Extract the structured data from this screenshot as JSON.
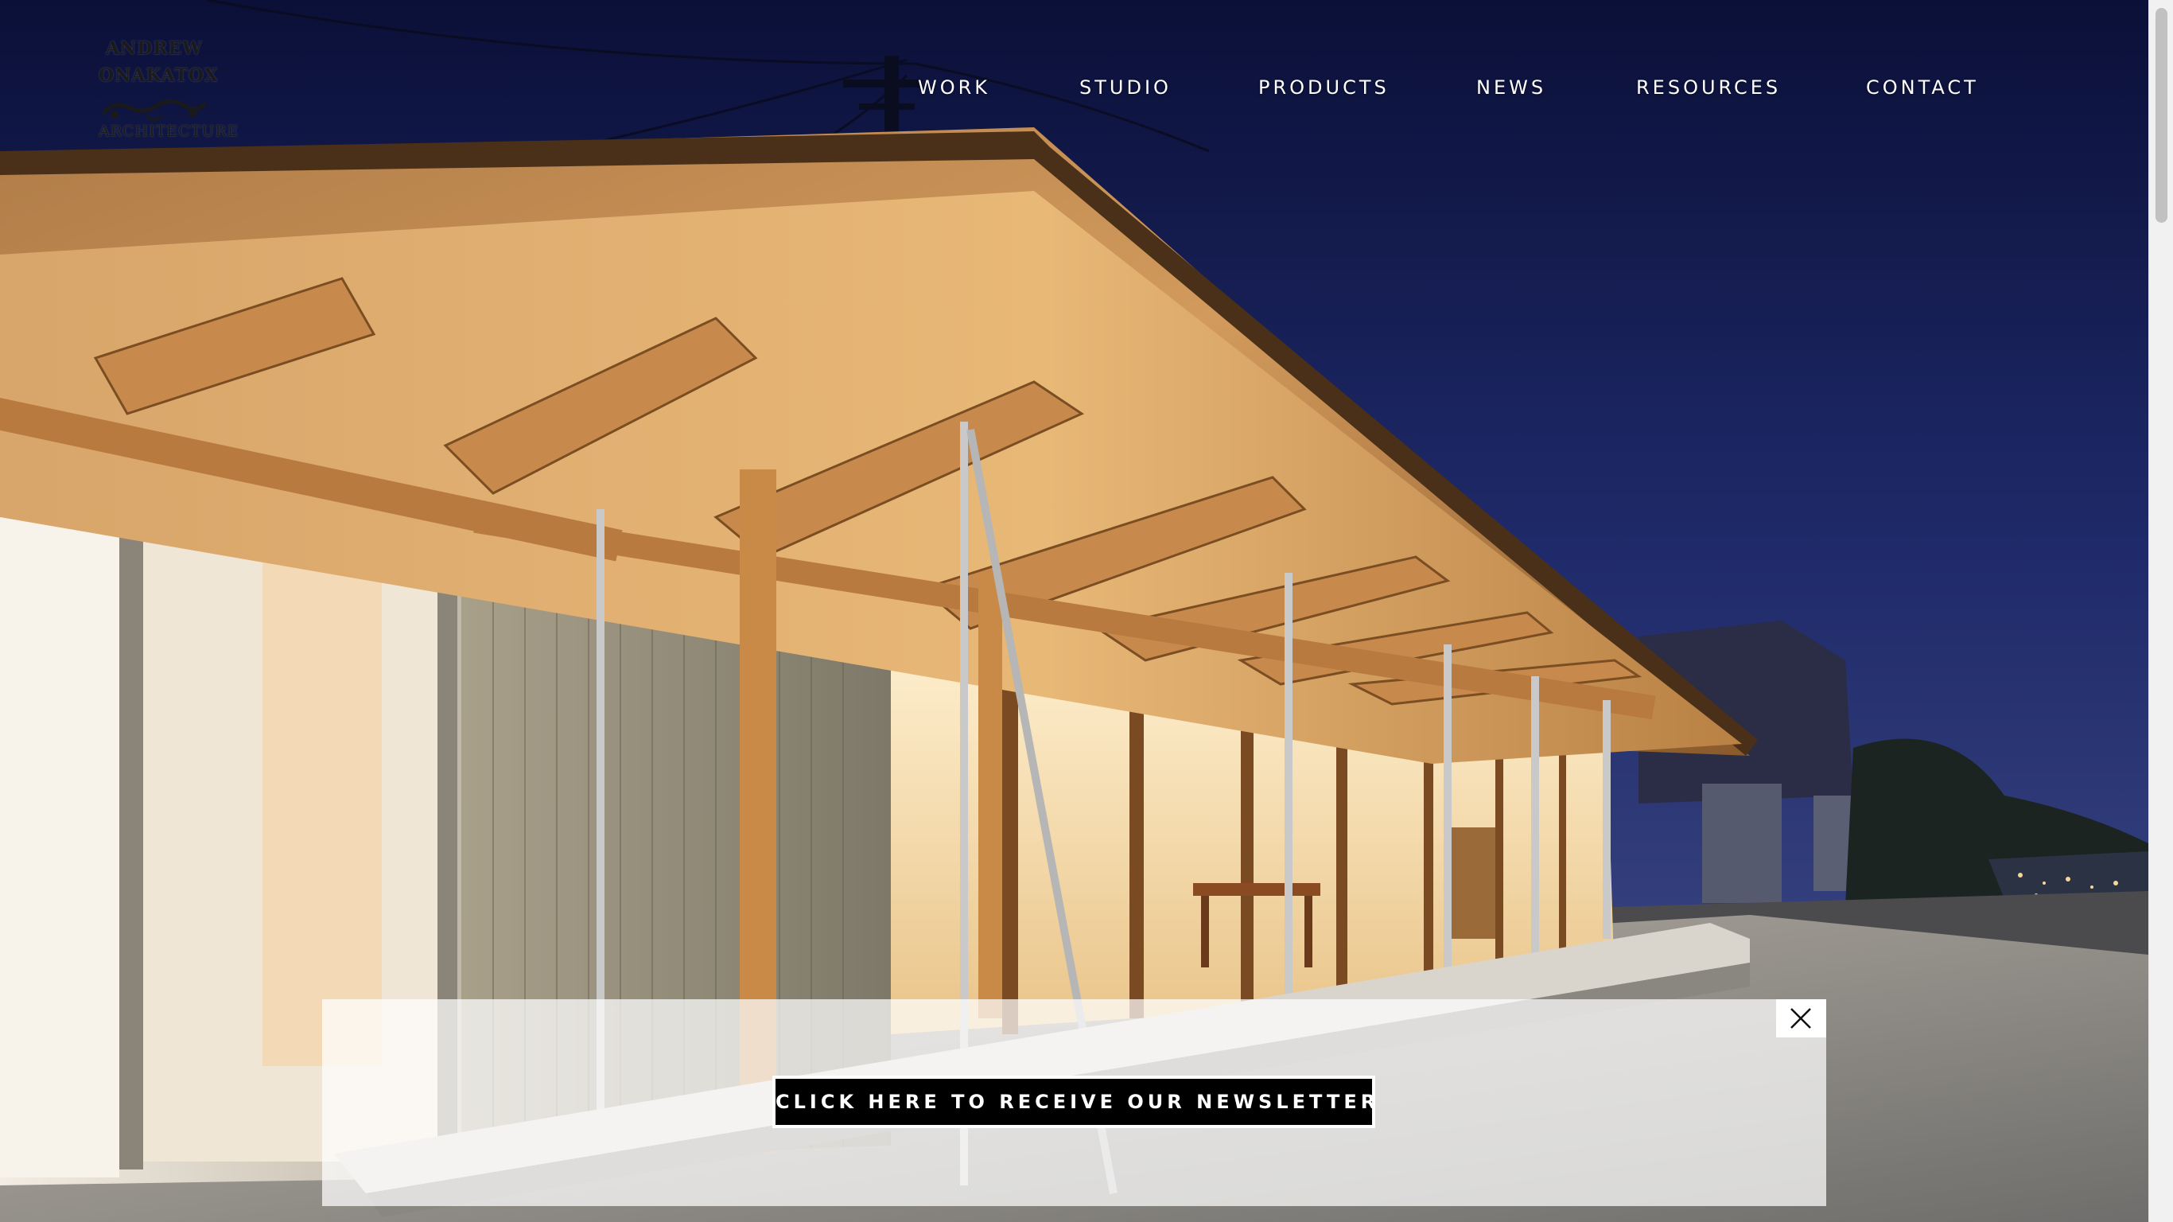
{
  "logo": {
    "line1": "ANDREW",
    "line2": "ONAKATOX",
    "line3": "ARCHITECTURE",
    "mark_icon": "creature-logo-mark-icon"
  },
  "nav": {
    "items": [
      {
        "label": "WORK"
      },
      {
        "label": "STUDIO"
      },
      {
        "label": "PRODUCTS"
      },
      {
        "label": "NEWS"
      },
      {
        "label": "RESOURCES"
      },
      {
        "label": "CONTACT"
      }
    ]
  },
  "hero": {
    "icon": "house-night-photo"
  },
  "newsletter": {
    "button_label": "CLICK HERE TO RECEIVE OUR NEWSLETTER",
    "close_icon": "close-icon"
  },
  "colors": {
    "sky_top": "#0c1240",
    "sky_bottom": "#3a4585",
    "wood": "#c98c4a",
    "button_bg": "#000000",
    "button_text": "#ffffff"
  }
}
